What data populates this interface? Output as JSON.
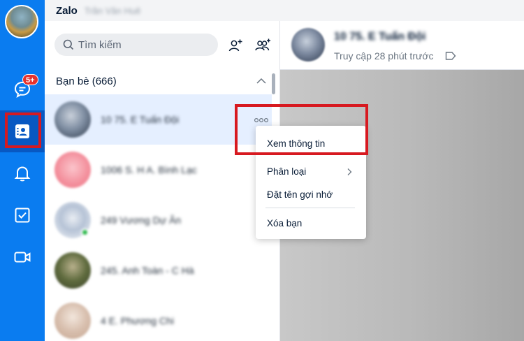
{
  "app": {
    "title": "Zalo",
    "user_name": "Trần Văn Huê"
  },
  "rail": {
    "badge": "5+",
    "items": [
      {
        "icon": "chat-icon"
      },
      {
        "icon": "contacts-icon"
      },
      {
        "icon": "bell-icon"
      },
      {
        "icon": "todo-check-icon"
      },
      {
        "icon": "video-call-icon"
      }
    ]
  },
  "search": {
    "placeholder": "Tìm kiếm"
  },
  "contacts": {
    "section_title": "Bạn bè (666)",
    "items": [
      {
        "name": "10 75. E Tuấn Đội"
      },
      {
        "name": "1006 S. H A. Bình Lạc"
      },
      {
        "name": "249 Vương Dự Ân"
      },
      {
        "name": "245. Anh Toàn - C Hà"
      },
      {
        "name": "4 E. Phương Chi"
      }
    ]
  },
  "context_menu": {
    "items": [
      "Xem thông tin",
      "Phân loại",
      "Đặt tên gợi nhớ",
      "Xóa bạn"
    ]
  },
  "chat": {
    "name": "10 75. E Tuấn Đội",
    "status": "Truy cập 28 phút trước"
  },
  "colors": {
    "rail": "#0a7cf0",
    "rail_active": "#0858c2",
    "highlight": "#d71920",
    "selected_row": "#e5efff"
  }
}
